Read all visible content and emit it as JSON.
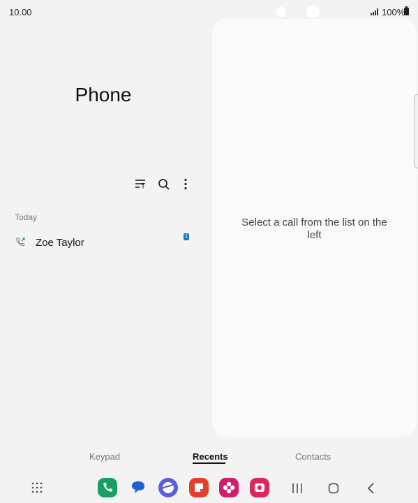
{
  "status": {
    "time": "10.00",
    "battery": "100%"
  },
  "app": {
    "title": "Phone"
  },
  "toolbar": {
    "filter_icon": "filter-icon",
    "search_icon": "search-icon",
    "more_icon": "more-options-icon"
  },
  "recents": {
    "section_label": "Today",
    "calls": [
      {
        "name": "Zoe Taylor",
        "badge": "1",
        "icon": "outgoing-call-icon"
      }
    ]
  },
  "detail": {
    "empty_message": "Select a call from the list on the left"
  },
  "tabs": [
    {
      "label": "Keypad",
      "active": false
    },
    {
      "label": "Recents",
      "active": true
    },
    {
      "label": "Contacts",
      "active": false
    }
  ],
  "dock": {
    "apps": [
      {
        "name": "phone-app-icon",
        "color": "#17a061"
      },
      {
        "name": "messages-app-icon",
        "color": "#1f5fd6"
      },
      {
        "name": "internet-app-icon",
        "color": "#5b5fd9"
      },
      {
        "name": "notes-app-icon",
        "color": "#e43f2d"
      },
      {
        "name": "gallery-app-icon",
        "color": "#d21d6f"
      },
      {
        "name": "camera-app-icon",
        "color": "#e0245e"
      }
    ]
  }
}
